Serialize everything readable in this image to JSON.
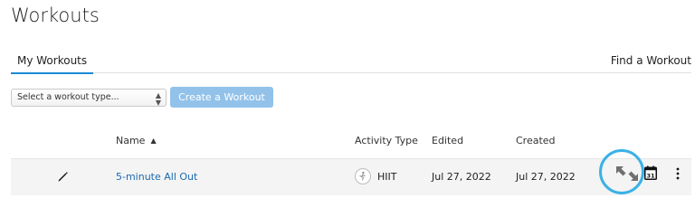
{
  "page": {
    "title": "Workouts"
  },
  "tabs": {
    "my_workouts": "My Workouts",
    "find_workout": "Find a Workout"
  },
  "toolbar": {
    "select_placeholder": "Select a workout type...",
    "create_button": "Create a Workout"
  },
  "table": {
    "headers": {
      "name": "Name",
      "activity_type": "Activity Type",
      "edited": "Edited",
      "created": "Created"
    },
    "sort_indicator": "▲",
    "rows": [
      {
        "name": "5-minute All Out",
        "activity_type": "HIIT",
        "edited": "Jul 27, 2022",
        "created": "Jul 27, 2022",
        "calendar_day": "31"
      }
    ]
  },
  "icons": {
    "edit": "pencil-icon",
    "activity": "hiit-activity-icon",
    "expand": "expand-arrows-icon",
    "calendar": "calendar-icon",
    "more": "more-vertical-icon"
  },
  "colors": {
    "accent": "#1a8ad6",
    "link": "#1a6ab0",
    "button_bg": "#92c2ea",
    "highlight": "#3ab1e6",
    "row_bg": "#f4f4f4"
  }
}
